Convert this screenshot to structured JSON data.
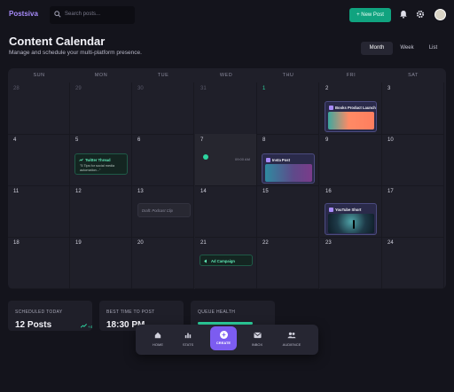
{
  "app": {
    "logo": "Postsiva"
  },
  "search": {
    "placeholder": "Search posts..."
  },
  "header": {
    "new_post_label": "+ New Post"
  },
  "page": {
    "title": "Content Calendar",
    "subtitle": "Manage and schedule your multi-platform presence."
  },
  "view_toggle": {
    "month": "Month",
    "week": "Week",
    "list": "List",
    "active": "Month"
  },
  "calendar": {
    "weekdays": [
      "SUN",
      "MON",
      "TUE",
      "WED",
      "THU",
      "FRI",
      "SAT"
    ],
    "rows": [
      [
        "28",
        "29",
        "30",
        "31",
        "1",
        "2",
        "3"
      ],
      [
        "4",
        "5",
        "6",
        "7",
        "8",
        "9",
        "10"
      ],
      [
        "11",
        "12",
        "13",
        "14",
        "15",
        "16",
        "17"
      ],
      [
        "18",
        "19",
        "20",
        "21",
        "22",
        "23",
        "24"
      ]
    ],
    "selected_time": "09:00 AM",
    "events": {
      "books": "Books Product Launch",
      "twitter_title": "Twitter Thread",
      "twitter_body": "\"5 Tips for social media automation...\"",
      "insta": "Insta Post",
      "draft": "Draft: Podcast Clip",
      "youtube": "YouTube Short",
      "ad": "Ad Campaign"
    }
  },
  "cards": {
    "scheduled": {
      "caption": "SCHEDULED TODAY",
      "value": "12 Posts",
      "trend": "+4"
    },
    "best_time": {
      "caption": "BEST TIME TO POST",
      "value": "18:30 PM"
    },
    "queue": {
      "caption": "QUEUE HEALTH"
    }
  },
  "nav": {
    "home": "HOME",
    "stats": "STATS",
    "create": "CREATE",
    "inbox": "INBOX",
    "audience": "AUDIENCE"
  },
  "colors": {
    "accent": "#7c5cf0",
    "brand_green": "#10a37f",
    "success": "#2dd4a0",
    "background": "#14141c"
  }
}
